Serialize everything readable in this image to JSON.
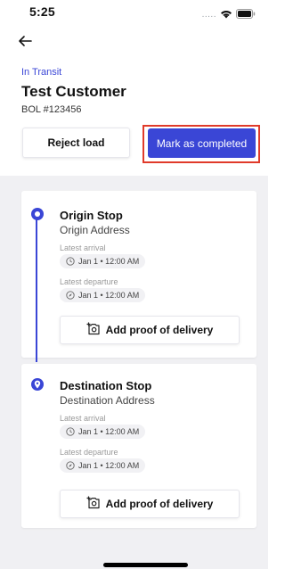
{
  "statusbar": {
    "time": "5:25",
    "dots": "....."
  },
  "header": {
    "status": "In Transit",
    "title": "Test Customer",
    "bol": "BOL #123456"
  },
  "actions": {
    "reject_label": "Reject load",
    "complete_label": "Mark as completed"
  },
  "stops": {
    "origin": {
      "title": "Origin Stop",
      "address": "Origin Address",
      "arrival_label": "Latest arrival",
      "arrival_value": "Jan 1 • 12:00 AM",
      "departure_label": "Latest departure",
      "departure_value": "Jan 1 • 12:00 AM",
      "proof_label": "Add proof of delivery"
    },
    "destination": {
      "title": "Destination Stop",
      "address": "Destination Address",
      "arrival_label": "Latest arrival",
      "arrival_value": "Jan 1 • 12:00 AM",
      "departure_label": "Latest departure",
      "departure_value": "Jan 1 • 12:00 AM",
      "proof_label": "Add proof of delivery"
    }
  },
  "colors": {
    "accent": "#3a46d6",
    "highlight": "#e03a2a",
    "background_gray": "#f0f0f3"
  },
  "icons": [
    "wifi-icon",
    "battery-icon",
    "back-arrow-icon",
    "clock-icon",
    "compass-icon",
    "add-photo-icon",
    "location-pin-icon"
  ]
}
